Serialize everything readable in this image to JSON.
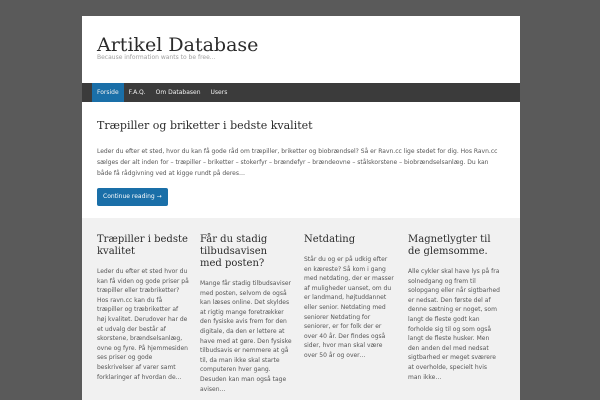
{
  "site": {
    "title": "Artikel Database",
    "description": "Because information wants to be free..."
  },
  "nav": {
    "items": [
      {
        "label": "Forside",
        "active": true
      },
      {
        "label": "F.A.Q.",
        "active": false
      },
      {
        "label": "Om Databasen",
        "active": false
      },
      {
        "label": "Users",
        "active": false
      }
    ]
  },
  "post": {
    "title": "Træpiller og briketter i bedste kvalitet",
    "body": "Leder du efter et sted, hvor du kan få gode råd om træpiller, briketter og biobrændsel? Så er Ravn.cc lige stedet for dig. Hos Ravn.cc sælges der alt inden for – træpiller – briketter – stokerfyr – brændefyr – brændeovne – stålskorstene – biobrændselsanlæg. Du kan både få rådgivning ved at kigge rundt på deres…",
    "continue_label": "Continue reading →"
  },
  "widgets": [
    {
      "title": "Træpiller i bedste kvalitet",
      "text": "Leder du efter et sted hvor du kan få viden og gode priser på træpiller eller træbriketter? Hos ravn.cc kan du få træpiller og træbriketter af høj kvalitet. Derudover har de et udvalg der består af skorstene, brændselsanlæg, ovne og fyre. På hjemmesiden ses priser og gode beskrivelser af varer samt forklaringer af hvordan de…"
    },
    {
      "title": "Får du stadig tilbudsavisen med posten?",
      "text": "Mange får stadig tilbudsaviser med posten, selvom de også kan læses online. Det skyldes at rigtig mange foretrækker den fysiske avis frem for den digitale, da den er lettere at have med at gøre. Den fysiske tilbudsavis er nemmere at gå til, da man ikke skal starte computeren hver gang. Desuden kan man også tage avisen…"
    },
    {
      "title": "Netdating",
      "text": "Står du og er på udkig efter en kæreste? Så kom i gang med netdating, der er masser af muligheder uanset, om du er landmand, højtuddannet eller senior. Netdating med seniorer Netdating for seniorer, er for folk der er over 40 år. Der findes også sider, hvor man skal være over 50 år og over…"
    },
    {
      "title": "Magnetlygter til de glemsomme.",
      "text": "Alle cykler skal have lys på fra solnedgang og frem til solopgang eller når sigtbarhed er nedsat. Den første del af denne sætning er noget, som langt de fleste godt kan forholde sig til og som også langt de fleste husker. Men den anden del med nedsat sigtbarhed er meget sværere at overholde, specielt hvis man ikke…"
    }
  ]
}
